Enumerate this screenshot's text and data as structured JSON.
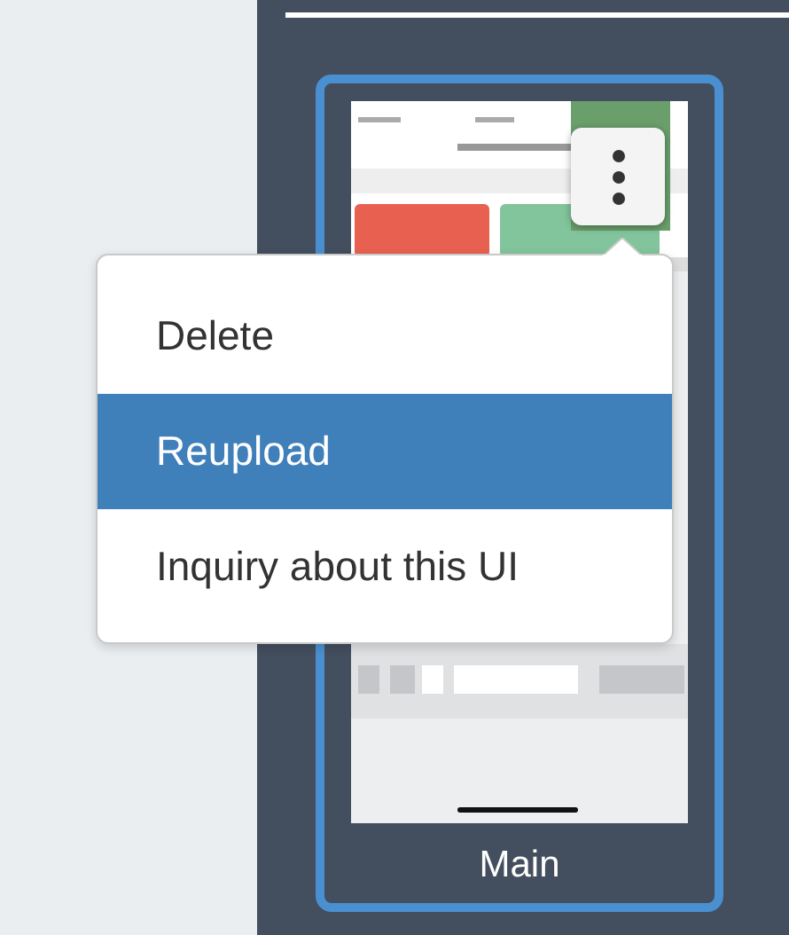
{
  "screen_card": {
    "label": "Main",
    "selected": true
  },
  "menu": {
    "items": [
      {
        "label": "Delete",
        "selected": false
      },
      {
        "label": "Reupload",
        "selected": true
      },
      {
        "label": "Inquiry about this UI",
        "selected": false
      }
    ]
  }
}
